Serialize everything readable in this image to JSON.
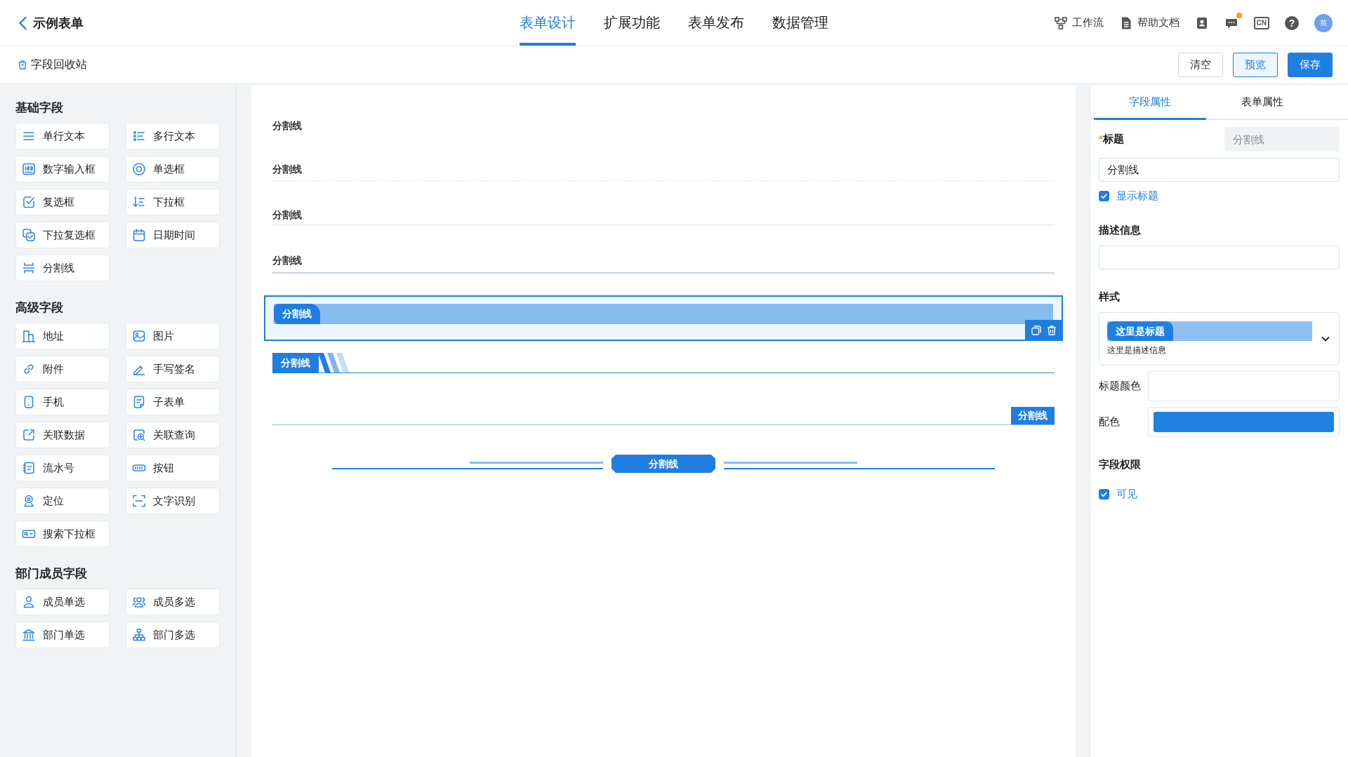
{
  "header": {
    "back_title": "示例表单",
    "nav": [
      {
        "label": "表单设计",
        "selected": true
      },
      {
        "label": "扩展功能",
        "selected": false
      },
      {
        "label": "表单发布",
        "selected": false
      },
      {
        "label": "数据管理",
        "selected": false
      }
    ],
    "tools": [
      {
        "kind": "workflow",
        "label": "工作流"
      },
      {
        "kind": "doc",
        "label": "帮助文档"
      }
    ],
    "icons": [
      {
        "kind": "contacts"
      },
      {
        "kind": "messages",
        "unread": true
      },
      {
        "kind": "language",
        "text": "CN"
      },
      {
        "kind": "help",
        "text": "?"
      }
    ],
    "avatar": "英"
  },
  "toolbar": {
    "recycle": "字段回收站",
    "buttons": [
      {
        "label": "清空",
        "kind": "default"
      },
      {
        "label": "预览",
        "kind": "outline"
      },
      {
        "label": "保存",
        "kind": "primary"
      }
    ]
  },
  "palette": [
    {
      "title": "基础字段",
      "items": [
        {
          "label": "单行文本",
          "kind": "text"
        },
        {
          "label": "多行文本",
          "kind": "textarea"
        },
        {
          "label": "数字输入框",
          "kind": "number"
        },
        {
          "label": "单选框",
          "kind": "radio"
        },
        {
          "label": "复选框",
          "kind": "checkbox"
        },
        {
          "label": "下拉框",
          "kind": "select"
        },
        {
          "label": "下拉复选框",
          "kind": "multiselect"
        },
        {
          "label": "日期时间",
          "kind": "datetime"
        },
        {
          "label": "分割线",
          "kind": "divider"
        }
      ]
    },
    {
      "title": "高级字段",
      "items": [
        {
          "label": "地址",
          "kind": "address"
        },
        {
          "label": "图片",
          "kind": "image"
        },
        {
          "label": "附件",
          "kind": "attachment"
        },
        {
          "label": "手写签名",
          "kind": "signature"
        },
        {
          "label": "手机",
          "kind": "phone"
        },
        {
          "label": "子表单",
          "kind": "subform"
        },
        {
          "label": "关联数据",
          "kind": "relation"
        },
        {
          "label": "关联查询",
          "kind": "query"
        },
        {
          "label": "流水号",
          "kind": "serial"
        },
        {
          "label": "按钮",
          "kind": "button"
        },
        {
          "label": "定位",
          "kind": "location"
        },
        {
          "label": "文字识别",
          "kind": "ocr"
        },
        {
          "label": "搜索下拉框",
          "kind": "search"
        }
      ]
    },
    {
      "title": "部门成员字段",
      "items": [
        {
          "label": "成员单选",
          "kind": "member"
        },
        {
          "label": "成员多选",
          "kind": "members"
        },
        {
          "label": "部门单选",
          "kind": "dept"
        },
        {
          "label": "部门多选",
          "kind": "depts"
        }
      ]
    }
  ],
  "canvas": {
    "items": [
      {
        "title": "分割线",
        "kind": "plain",
        "selected": false
      },
      {
        "title": "分割线",
        "kind": "dashed",
        "selected": false
      },
      {
        "title": "分割线",
        "kind": "thin",
        "selected": false
      },
      {
        "title": "分割线",
        "kind": "thick",
        "selected": false
      },
      {
        "title": "分割线",
        "kind": "banner",
        "selected": true
      },
      {
        "title": "分割线",
        "kind": "stripes",
        "selected": false
      },
      {
        "title": "分割线",
        "kind": "right-tag",
        "selected": false
      },
      {
        "title": "分割线",
        "kind": "ornament",
        "selected": false
      }
    ]
  },
  "properties": {
    "tabs": [
      {
        "label": "字段属性",
        "selected": true
      },
      {
        "label": "表单属性",
        "selected": false
      }
    ],
    "required_mark": "*",
    "title_label": "标题",
    "type_name": "分割线",
    "title_value": "分割线",
    "show_title": {
      "label": "显示标题",
      "checked": true
    },
    "description_label": "描述信息",
    "style_label": "样式",
    "style_preview": {
      "title": "这里是标题",
      "description": "这里是描述信息"
    },
    "title_color_label": "标题颜色",
    "scheme_label": "配色",
    "permission_label": "字段权限",
    "visible": {
      "label": "可见",
      "checked": true
    }
  }
}
